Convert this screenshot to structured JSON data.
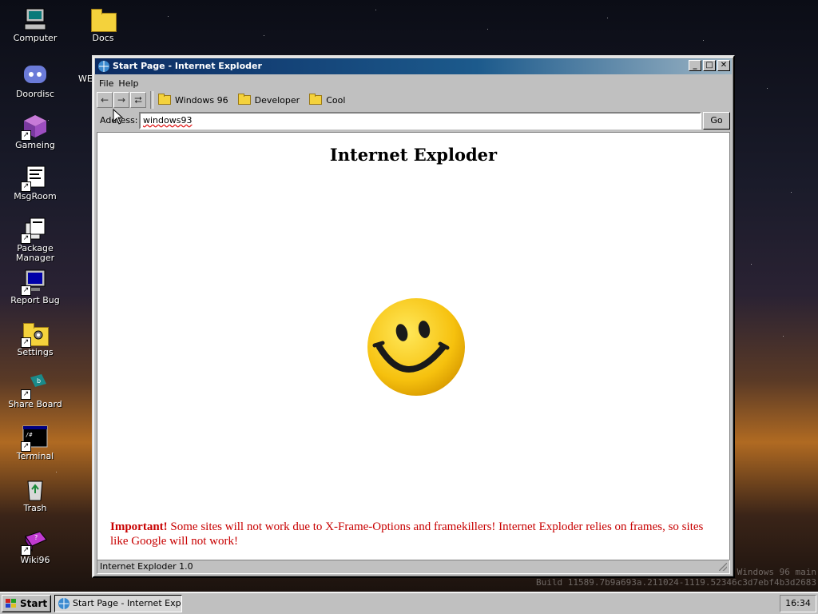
{
  "desktop": {
    "icons": [
      {
        "label": "Computer",
        "icon": "computer-icon"
      },
      {
        "label": "Docs",
        "icon": "folder-icon"
      },
      {
        "label": "Doordisc",
        "icon": "chat-app-icon"
      },
      {
        "label": "WE",
        "icon": "partially-hidden-icon"
      },
      {
        "label": "Gameing",
        "icon": "cube-icon"
      },
      {
        "label": "MsgRoom",
        "icon": "message-icon"
      },
      {
        "label": "Package Manager",
        "icon": "package-icon"
      },
      {
        "label": "Report Bug",
        "icon": "monitor-icon"
      },
      {
        "label": "Settings",
        "icon": "settings-folder-icon"
      },
      {
        "label": "Share Board",
        "icon": "share-board-icon"
      },
      {
        "label": "Terminal",
        "icon": "terminal-icon"
      },
      {
        "label": "Trash",
        "icon": "recycle-bin-icon"
      },
      {
        "label": "Wiki96",
        "icon": "book-icon"
      }
    ],
    "build_lines": [
      "Windows 96 main",
      "Build 11589.7b9a693a.211024-1119.52346c3d7ebf4b3d2683"
    ]
  },
  "window": {
    "title": "Start Page - Internet Exploder",
    "menu": [
      "File",
      "Help"
    ],
    "nav": {
      "back": "←",
      "forward": "→",
      "refresh": "⮂"
    },
    "bookmarks": [
      "Windows 96",
      "Developer",
      "Cool"
    ],
    "address": {
      "label": "Address:",
      "value": "windows93",
      "go_label": "Go"
    },
    "page": {
      "heading": "Internet Exploder",
      "important_label": "Important!",
      "important_text": " Some sites will not work due to X-Frame-Options and framekillers! Internet Exploder relies on frames, so sites like Google will not work!"
    },
    "status": "Internet Exploder 1.0"
  },
  "taskbar": {
    "start_label": "Start",
    "task_label": "Start Page - Internet Exp...",
    "clock": "16:34"
  },
  "colors": {
    "titlebar_start": "#0c2b62",
    "titlebar_end": "#9cb4c4",
    "important": "#c80000",
    "chrome": "#c0c0c0"
  }
}
